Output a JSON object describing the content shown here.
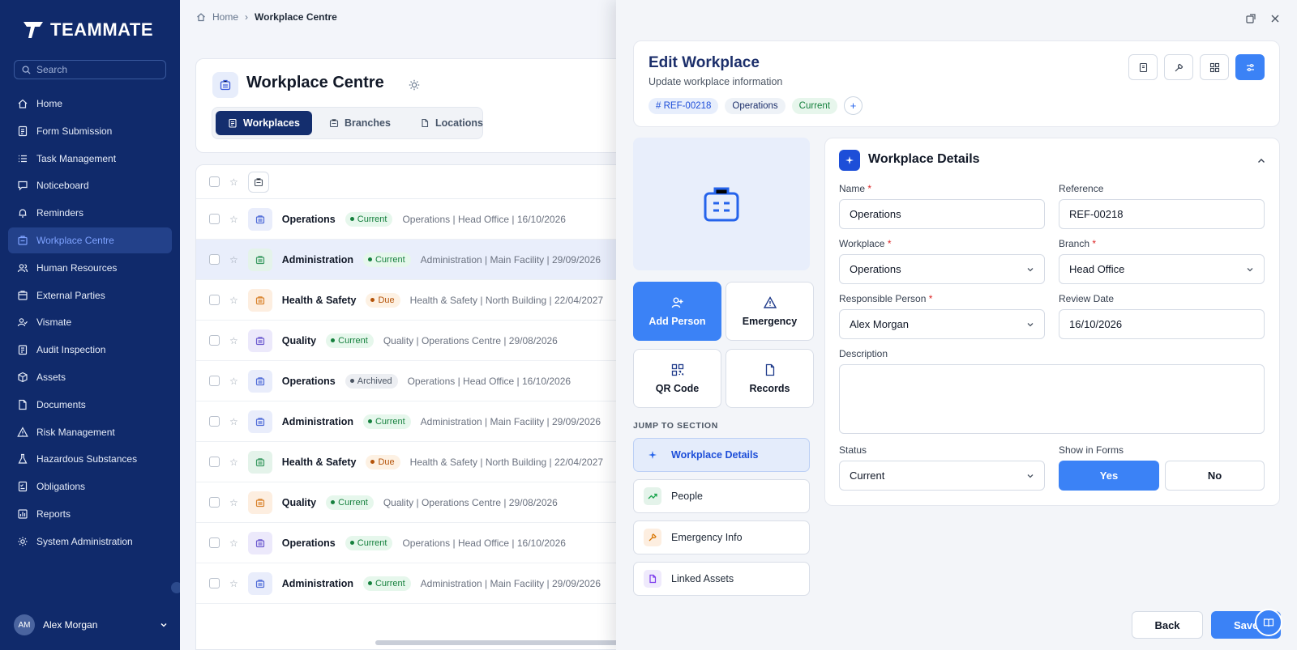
{
  "app": {
    "name": "TEAMMATE"
  },
  "search": {
    "placeholder": "Search"
  },
  "nav": [
    {
      "label": "Home",
      "icon": "home-icon"
    },
    {
      "label": "Form Submission",
      "icon": "form-icon"
    },
    {
      "label": "Task Management",
      "icon": "tasks-icon"
    },
    {
      "label": "Noticeboard",
      "icon": "message-icon"
    },
    {
      "label": "Reminders",
      "icon": "bell-icon"
    },
    {
      "label": "Workplace Centre",
      "icon": "briefcase-icon",
      "active": true
    },
    {
      "label": "Human Resources",
      "icon": "users-icon"
    },
    {
      "label": "External Parties",
      "icon": "building-icon"
    },
    {
      "label": "Vismate",
      "icon": "user-check-icon"
    },
    {
      "label": "Audit Inspection",
      "icon": "clipboard-icon"
    },
    {
      "label": "Assets",
      "icon": "box-icon"
    },
    {
      "label": "Documents",
      "icon": "document-icon"
    },
    {
      "label": "Risk Management",
      "icon": "warning-icon"
    },
    {
      "label": "Hazardous Substances",
      "icon": "flask-icon"
    },
    {
      "label": "Obligations",
      "icon": "checklist-icon"
    },
    {
      "label": "Reports",
      "icon": "chart-icon"
    },
    {
      "label": "System Administration",
      "icon": "gear-icon"
    }
  ],
  "user": {
    "initials": "AM",
    "name": "Alex Morgan"
  },
  "breadcrumb": {
    "home": "Home",
    "current": "Workplace Centre"
  },
  "page": {
    "title": "Workplace Centre",
    "tabs": [
      {
        "label": "Workplaces",
        "active": true
      },
      {
        "label": "Branches"
      },
      {
        "label": "Locations"
      }
    ]
  },
  "rows": [
    {
      "name": "Operations",
      "status": "Current",
      "status_type": "current",
      "info": "Operations | Head Office | 16/10/2026",
      "icon_bg": "#e9edfb",
      "icon_color": "#4f6bd8"
    },
    {
      "name": "Administration",
      "status": "Current",
      "status_type": "current",
      "info": "Administration | Main Facility | 29/09/2026",
      "icon_bg": "#e4f3ea",
      "icon_color": "#3a9a62",
      "selected": true
    },
    {
      "name": "Health & Safety",
      "status": "Due",
      "status_type": "due",
      "info": "Health & Safety | North Building | 22/04/2027",
      "icon_bg": "#fdeee0",
      "icon_color": "#d9822b"
    },
    {
      "name": "Quality",
      "status": "Current",
      "status_type": "current",
      "info": "Quality | Operations Centre | 29/08/2026",
      "icon_bg": "#ece9fb",
      "icon_color": "#6d5bd0"
    },
    {
      "name": "Operations",
      "status": "Archived",
      "status_type": "archived",
      "info": "Operations | Head Office | 16/10/2026",
      "icon_bg": "#e9edfb",
      "icon_color": "#4f6bd8"
    },
    {
      "name": "Administration",
      "status": "Current",
      "status_type": "current",
      "info": "Administration | Main Facility | 29/09/2026",
      "icon_bg": "#e9edfb",
      "icon_color": "#4f6bd8"
    },
    {
      "name": "Health & Safety",
      "status": "Due",
      "status_type": "due",
      "info": "Health & Safety | North Building | 22/04/2027",
      "icon_bg": "#e4f3ea",
      "icon_color": "#3a9a62"
    },
    {
      "name": "Quality",
      "status": "Current",
      "status_type": "current",
      "info": "Quality | Operations Centre | 29/08/2026",
      "icon_bg": "#fdeee0",
      "icon_color": "#d9822b"
    },
    {
      "name": "Operations",
      "status": "Current",
      "status_type": "current",
      "info": "Operations | Head Office | 16/10/2026",
      "icon_bg": "#ece9fb",
      "icon_color": "#6d5bd0"
    },
    {
      "name": "Administration",
      "status": "Current",
      "status_type": "current",
      "info": "Administration | Main Facility | 29/09/2026",
      "icon_bg": "#e9edfb",
      "icon_color": "#4f6bd8"
    }
  ],
  "panel": {
    "title": "Edit Workplace",
    "subtitle": "Update workplace information",
    "chips": {
      "ref": "# REF-00218",
      "category": "Operations",
      "status": "Current",
      "add": "+"
    },
    "quick_actions": [
      {
        "label": "Add Person",
        "icon": "add-person-icon",
        "primary": true
      },
      {
        "label": "Emergency",
        "icon": "warning-icon"
      },
      {
        "label": "QR Code",
        "icon": "qr-code-icon"
      },
      {
        "label": "Records",
        "icon": "document-icon"
      }
    ],
    "jump_label": "JUMP TO SECTION",
    "jump": [
      {
        "label": "Workplace Details",
        "icon": "sparkle-icon",
        "active": true
      },
      {
        "label": "People",
        "icon": "trend-icon"
      },
      {
        "label": "Emergency Info",
        "icon": "wrench-icon"
      },
      {
        "label": "Linked Assets",
        "icon": "document-icon"
      }
    ],
    "details": {
      "title": "Workplace Details",
      "name_label": "Name",
      "name_value": "Operations",
      "reference_label": "Reference",
      "reference_value": "REF-00218",
      "workplace_label": "Workplace",
      "workplace_value": "Operations",
      "branch_label": "Branch",
      "branch_value": "Head Office",
      "responsible_label": "Responsible Person",
      "responsible_value": "Alex Morgan",
      "review_label": "Review Date",
      "review_value": "16/10/2026",
      "description_label": "Description",
      "description_value": "",
      "status_label": "Status",
      "status_value": "Current",
      "show_label": "Show in Forms",
      "yes": "Yes",
      "no": "No",
      "required_mark": "*"
    },
    "back": "Back",
    "save": "Save"
  }
}
